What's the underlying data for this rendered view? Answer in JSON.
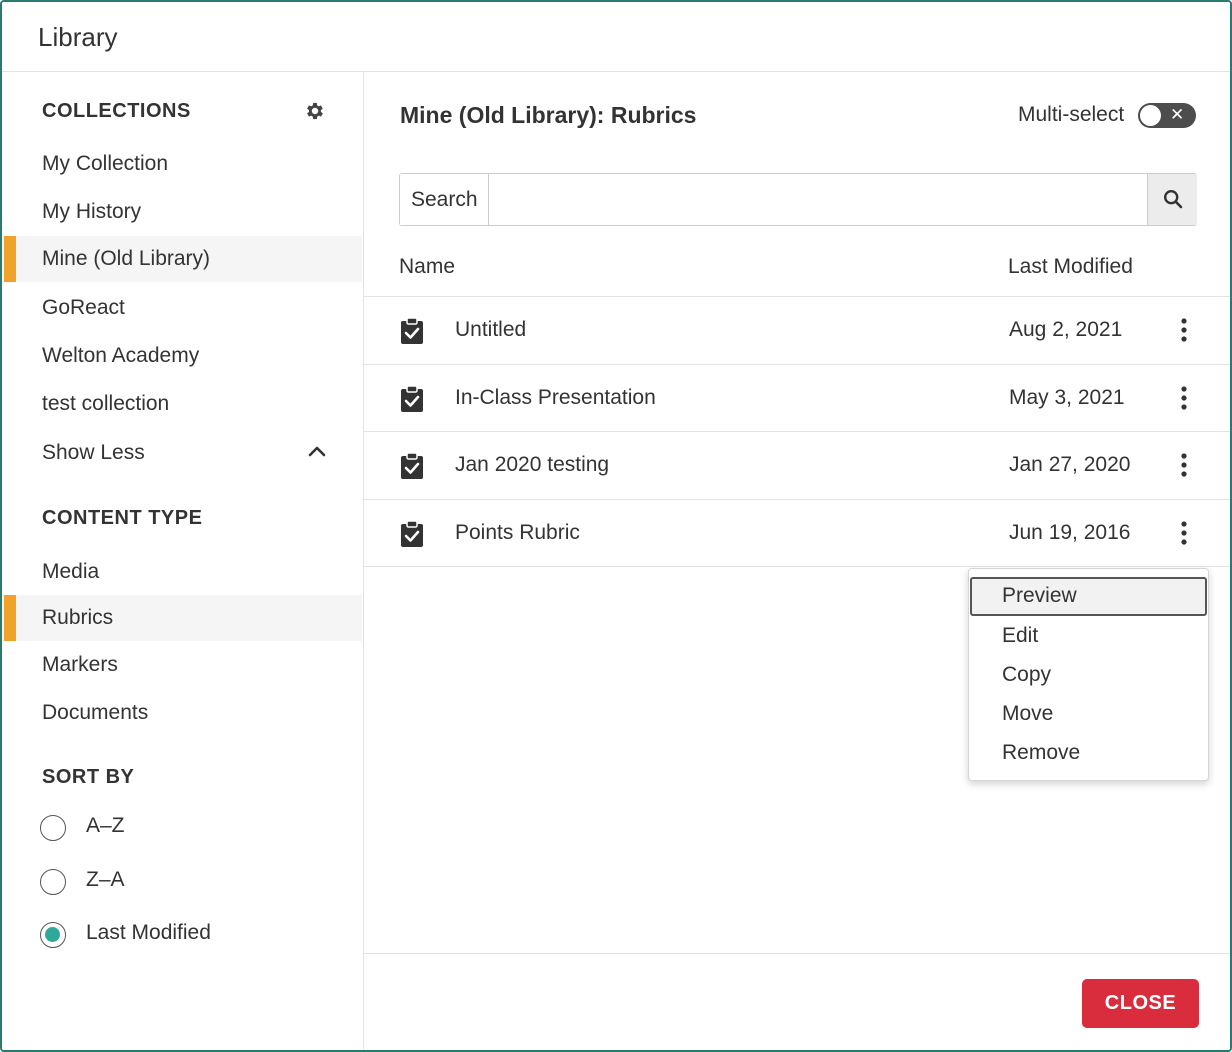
{
  "dialog": {
    "title": "Library"
  },
  "sidebar": {
    "collections_heading": "COLLECTIONS",
    "collections": [
      {
        "label": "My Collection",
        "active": false
      },
      {
        "label": "My History",
        "active": false
      },
      {
        "label": "Mine (Old Library)",
        "active": true
      },
      {
        "label": "GoReact",
        "active": false
      },
      {
        "label": "Welton Academy",
        "active": false
      },
      {
        "label": "test collection",
        "active": false
      }
    ],
    "show_less_label": "Show Less",
    "content_type_heading": "CONTENT TYPE",
    "content_types": [
      {
        "label": "Media",
        "active": false
      },
      {
        "label": "Rubrics",
        "active": true
      },
      {
        "label": "Markers",
        "active": false
      },
      {
        "label": "Documents",
        "active": false
      }
    ],
    "sort_heading": "SORT BY",
    "sort_options": [
      {
        "label": "A–Z",
        "checked": false
      },
      {
        "label": "Z–A",
        "checked": false
      },
      {
        "label": "Last Modified",
        "checked": true
      }
    ]
  },
  "main": {
    "title": "Mine (Old Library): Rubrics",
    "multi_select_label": "Multi-select",
    "multi_select_on": false,
    "search": {
      "addon_label": "Search",
      "value": "",
      "placeholder": ""
    },
    "columns": {
      "name": "Name",
      "last_modified": "Last Modified"
    },
    "rows": [
      {
        "name": "Untitled",
        "date": "Aug 2, 2021"
      },
      {
        "name": "In-Class Presentation",
        "date": "May 3, 2021"
      },
      {
        "name": "Jan 2020 testing",
        "date": "Jan 27, 2020"
      },
      {
        "name": "Points Rubric",
        "date": "Jun 19, 2016"
      }
    ],
    "context_menu": {
      "items": [
        {
          "label": "Preview",
          "focused": true
        },
        {
          "label": "Edit",
          "focused": false
        },
        {
          "label": "Copy",
          "focused": false
        },
        {
          "label": "Move",
          "focused": false
        },
        {
          "label": "Remove",
          "focused": false
        }
      ]
    },
    "close_label": "CLOSE"
  },
  "colors": {
    "accent_active": "#f0a22a",
    "radio_checked": "#2fa89a",
    "close_button": "#d92d3e",
    "toggle_off": "#4d4d4d"
  },
  "icons": {
    "gear": "gear-icon",
    "chevron": "chevron-up-icon",
    "search": "search-icon",
    "rubric": "clipboard-check-icon",
    "kebab": "more-vertical-icon"
  }
}
